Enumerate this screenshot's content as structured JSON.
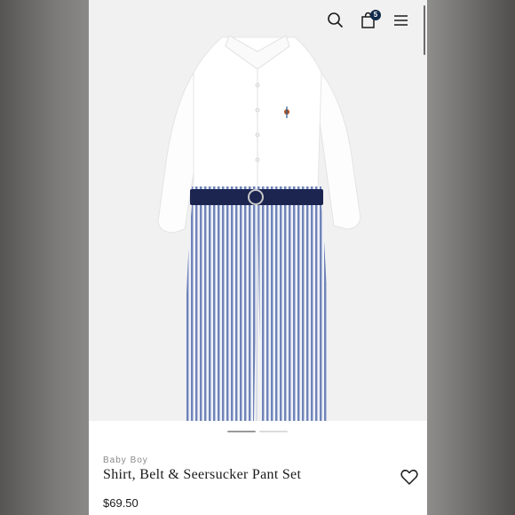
{
  "header": {
    "search_icon": "search-icon",
    "bag_icon": "shopping-bag-icon",
    "bag_count": "5",
    "menu_icon": "menu-icon"
  },
  "gallery": {
    "image": "product-image-shirt-belt-pants",
    "total_slides": 2,
    "active_slide": 1
  },
  "product": {
    "category": "Baby Boy",
    "title": "Shirt, Belt & Seersucker Pant Set",
    "price": "$69.50",
    "wishlist_icon": "heart-icon"
  },
  "colors": {
    "brand_navy": "#0f2b4a",
    "belt_navy": "#1b2550",
    "seersucker_blue": "#6f83b8"
  }
}
